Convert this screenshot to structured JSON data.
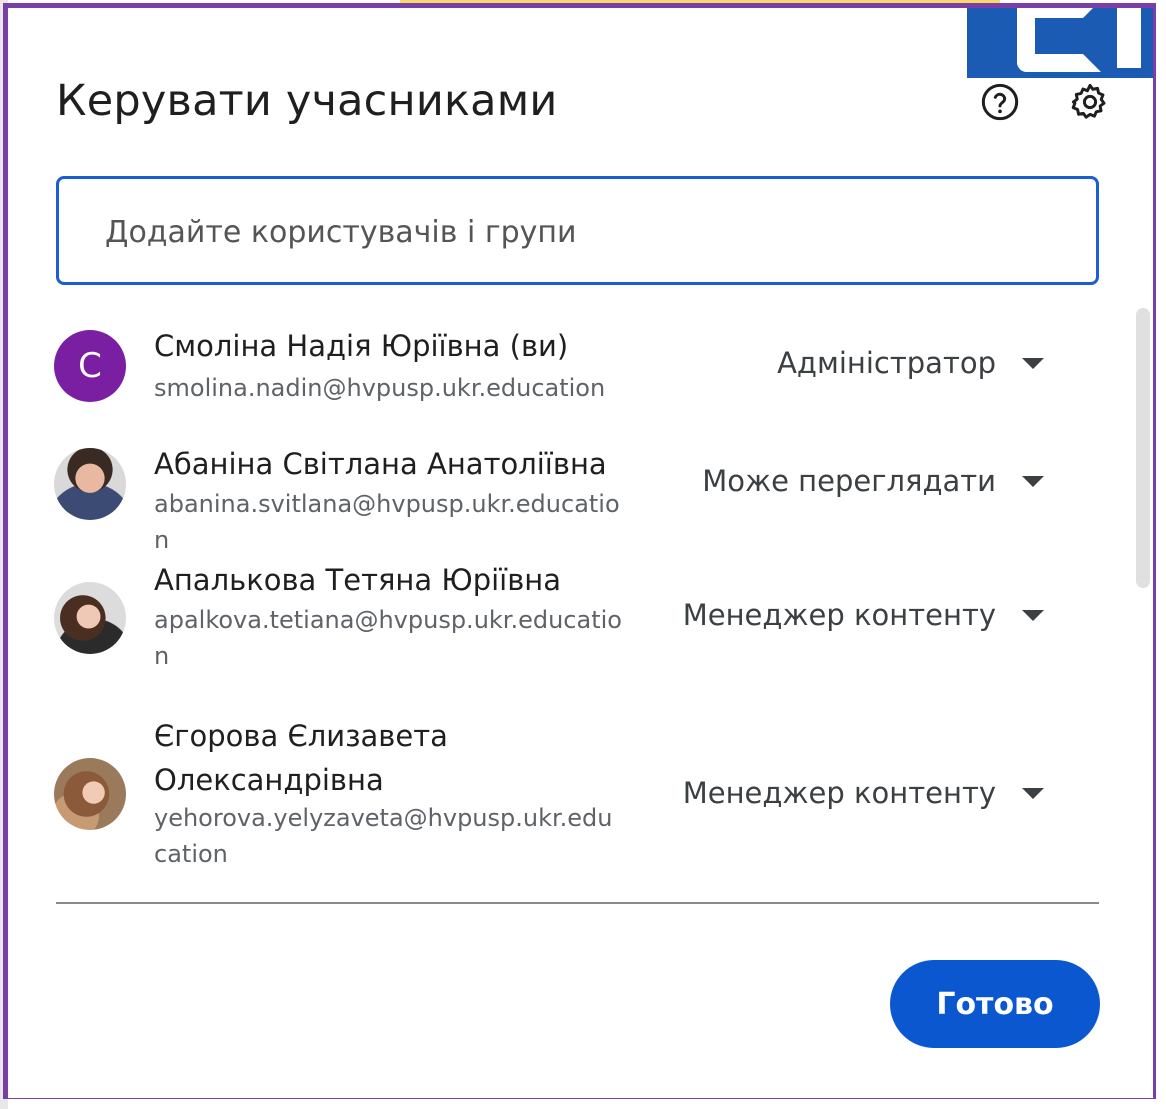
{
  "dialog": {
    "title": "Керувати учасниками",
    "help_icon": "help-circle-icon",
    "settings_icon": "gear-icon"
  },
  "search": {
    "placeholder": "Додайте користувачів і групи"
  },
  "people": [
    {
      "name": "Смоліна Надія Юріївна (ви)",
      "email": "smolina.nadin@hvpusp.ukr.education",
      "avatar_letter": "С",
      "role": "Адміністратор"
    },
    {
      "name": "Абаніна Світлана Анатоліївна",
      "email": "abanina.svitlana@hvpusp.ukr.education",
      "role": "Може переглядати"
    },
    {
      "name": "Апалькова Тетяна Юріївна",
      "email": "apalkova.tetiana@hvpusp.ukr.education",
      "role": "Менеджер контенту"
    },
    {
      "name": "Єгорова Єлизавета Олександрівна",
      "email": "yehorova.yelyzaveta@hvpusp.ukr.education",
      "role": "Менеджер контенту"
    }
  ],
  "footer": {
    "done_label": "Готово"
  },
  "colors": {
    "accent": "#0b57d0",
    "frame": "#7a3fa6",
    "avatar_letter_bg": "#7b1fa2"
  }
}
